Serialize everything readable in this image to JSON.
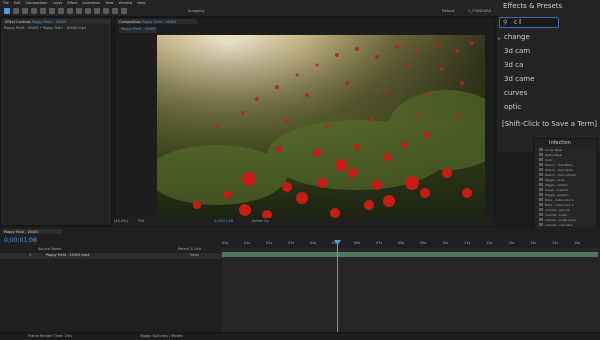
{
  "menu": [
    "File",
    "Edit",
    "Composition",
    "Layer",
    "Effect",
    "Animation",
    "View",
    "Window",
    "Help"
  ],
  "toolbar": {
    "snapping": "Snapping",
    "workspace": "Default",
    "project_name": "1_STANDARD"
  },
  "project_panel": {
    "tab": "Effect Controls",
    "tab_highlight": "Poppy Field - 16405",
    "breadcrumb": "Poppy Field - 16405 • Poppy Field - 16405.mp4"
  },
  "comp_panel": {
    "tab_prefix": "Composition",
    "tab_name": "Poppy Field - 16405",
    "subtab": "Poppy Field - 16405",
    "zoom": "(44.4%)",
    "resolution": "Full",
    "timecode": "0;00;01;08",
    "view": "Active Ca"
  },
  "effects_presets": {
    "title": "Effects & Presets",
    "search_value": "c",
    "items": [
      "change",
      "3d cam",
      "3d ca",
      "3d came",
      "curves",
      "optic"
    ],
    "tip": "[Shift-Click to Save a Term]"
  },
  "list_panel": {
    "title": "Infection",
    "rows": [
      "Linear Wipe",
      "Radial Wipe",
      "Color ...",
      "Fade In - from Black",
      "Fade In - from white",
      "Fade In - from rotation",
      "Wiggle - scale",
      "Wiggle - rotation",
      "Image - Creative",
      "Wiggle - position",
      "Blurs - motion blur 1",
      "Blurs - motion blur 2",
      "Colorize - gold dk",
      "Colorize - tinted",
      "Colorize - tinted warm",
      "Colorize - cold hard",
      "Colorize - red hard",
      "Colorize - sepia",
      "Colorize - sky blue"
    ]
  },
  "timeline": {
    "tab": "Poppy Field - 16405",
    "timecode": "0;00;01;08",
    "columns": [
      "Source Name",
      "Parent & Link"
    ],
    "layer_index": "1",
    "layer_name": "Poppy Field - 16405.mp4",
    "parent": "None",
    "ruler": [
      "00s",
      "01s",
      "02s",
      "03s",
      "04s",
      "05s",
      "06s",
      "07s",
      "08s",
      "09s",
      "10s",
      "11s",
      "12s",
      "13s",
      "14s",
      "15s",
      "16s"
    ],
    "toggle_label": "Toggle Switches / Modes",
    "render_label": "Frame Render Time: 1ms"
  },
  "colors": {
    "accent": "#4b9dea",
    "panel": "#232323",
    "layer": "#4f7a62"
  }
}
